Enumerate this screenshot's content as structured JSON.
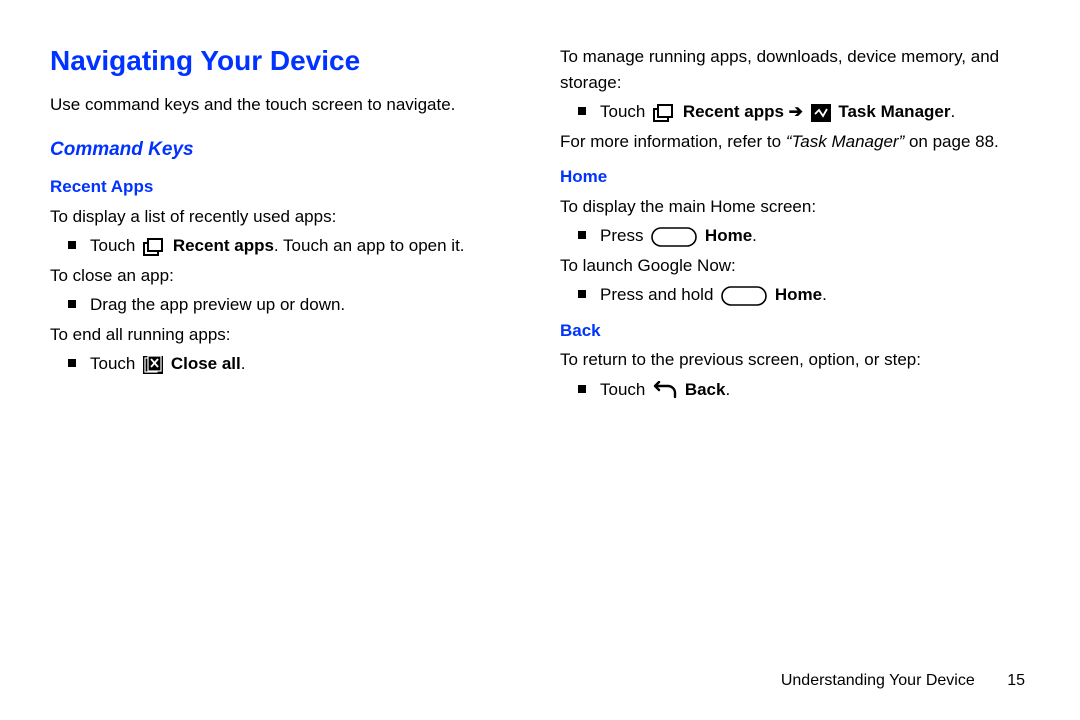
{
  "title": "Navigating Your Device",
  "intro": "Use command keys and the touch screen to navigate.",
  "subtitle": "Command Keys",
  "recent": {
    "heading": "Recent Apps",
    "p1": "To display a list of recently used apps:",
    "b1_pre": "Touch ",
    "b1_bold": "Recent apps",
    "b1_post": ". Touch an app to open it.",
    "p2": "To close an app:",
    "b2": "Drag the app preview up or down.",
    "p3": "To end all running apps:",
    "b3_pre": "Touch ",
    "b3_bold": "Close all",
    "b3_post": "."
  },
  "col2": {
    "p1": "To manage running apps, downloads, device memory, and storage:",
    "b1_pre": "Touch ",
    "b1_mid1": "Recent apps",
    "b1_arrow": " ➔ ",
    "b1_mid2": "Task Manager",
    "b1_post": ".",
    "p2_pre": "For more information, refer to ",
    "p2_ital": "“Task Manager”",
    "p2_post": " on page 88."
  },
  "home": {
    "heading": "Home",
    "p1": "To display the main Home screen:",
    "b1_pre": "Press ",
    "b1_bold": "Home",
    "b1_post": ".",
    "p2": "To launch Google Now:",
    "b2_pre": "Press and hold ",
    "b2_bold": "Home",
    "b2_post": "."
  },
  "back": {
    "heading": "Back",
    "p1": "To return to the previous screen, option, or step:",
    "b1_pre": "Touch ",
    "b1_bold": "Back",
    "b1_post": "."
  },
  "footer": {
    "chapter": "Understanding Your Device",
    "page": "15"
  }
}
